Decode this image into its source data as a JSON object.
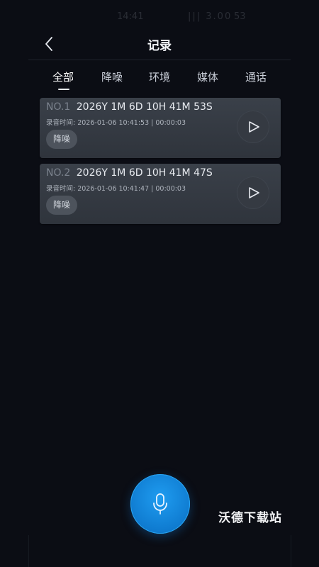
{
  "status_bar": {
    "time": "14:41",
    "network": "||| 3.00",
    "battery": "53"
  },
  "header": {
    "title": "记录",
    "back_icon": "chevron-left-icon"
  },
  "tabs": [
    {
      "label": "全部",
      "active": true
    },
    {
      "label": "降噪",
      "active": false
    },
    {
      "label": "环境",
      "active": false
    },
    {
      "label": "媒体",
      "active": false
    },
    {
      "label": "通话",
      "active": false
    }
  ],
  "records": [
    {
      "no": "NO.1",
      "name": "2026Y 1M 6D 10H 41M 53S",
      "meta": "录音时间: 2026-01-06 10:41:53 | 00:00:03",
      "tag": "降噪",
      "play_icon": "play-icon"
    },
    {
      "no": "NO.2",
      "name": "2026Y 1M 6D 10H 41M 47S",
      "meta": "录音时间: 2026-01-06 10:41:47 | 00:00:03",
      "tag": "降噪",
      "play_icon": "play-icon"
    }
  ],
  "mic_button": {
    "icon": "microphone-icon",
    "color": "#1a8fe3"
  },
  "watermark": "沃德下载站",
  "colors": {
    "background": "#0b0d14",
    "card": "#353a42",
    "accent": "#1a8fe3"
  }
}
